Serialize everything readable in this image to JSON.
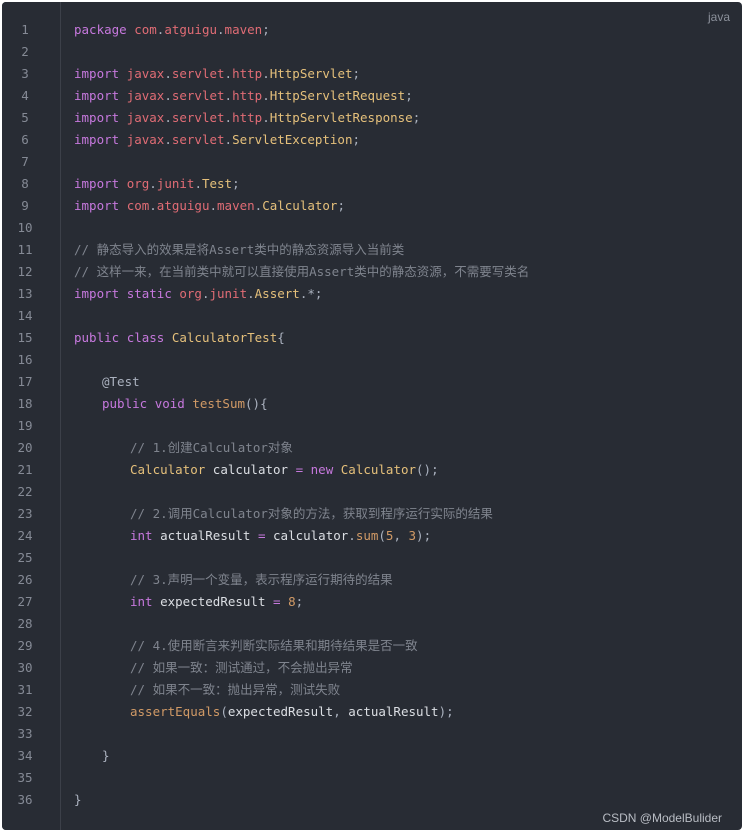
{
  "code_block": {
    "language_label": "java",
    "watermark": "CSDN @ModelBulider",
    "colors": {
      "background": "#282c34",
      "keyword": "#c678dd",
      "package": "#e06c75",
      "class": "#e5c07b",
      "comment": "#7f848e",
      "function_and_number": "#d19a66",
      "plain": "#abb2bf"
    },
    "lines": [
      {
        "n": "1",
        "indent": 0,
        "tokens": [
          [
            "kw",
            "package"
          ],
          [
            "pl",
            " "
          ],
          [
            "pkg",
            "com"
          ],
          [
            "pl",
            "."
          ],
          [
            "pkg",
            "atguigu"
          ],
          [
            "pl",
            "."
          ],
          [
            "pkg",
            "maven"
          ],
          [
            "pl",
            ";"
          ]
        ]
      },
      {
        "n": "2",
        "indent": 0,
        "tokens": []
      },
      {
        "n": "3",
        "indent": 0,
        "tokens": [
          [
            "kw",
            "import"
          ],
          [
            "pl",
            " "
          ],
          [
            "pkg",
            "javax"
          ],
          [
            "pl",
            "."
          ],
          [
            "pkg",
            "servlet"
          ],
          [
            "pl",
            "."
          ],
          [
            "pkg",
            "http"
          ],
          [
            "pl",
            "."
          ],
          [
            "cls",
            "HttpServlet"
          ],
          [
            "pl",
            ";"
          ]
        ]
      },
      {
        "n": "4",
        "indent": 0,
        "tokens": [
          [
            "kw",
            "import"
          ],
          [
            "pl",
            " "
          ],
          [
            "pkg",
            "javax"
          ],
          [
            "pl",
            "."
          ],
          [
            "pkg",
            "servlet"
          ],
          [
            "pl",
            "."
          ],
          [
            "pkg",
            "http"
          ],
          [
            "pl",
            "."
          ],
          [
            "cls",
            "HttpServletRequest"
          ],
          [
            "pl",
            ";"
          ]
        ]
      },
      {
        "n": "5",
        "indent": 0,
        "tokens": [
          [
            "kw",
            "import"
          ],
          [
            "pl",
            " "
          ],
          [
            "pkg",
            "javax"
          ],
          [
            "pl",
            "."
          ],
          [
            "pkg",
            "servlet"
          ],
          [
            "pl",
            "."
          ],
          [
            "pkg",
            "http"
          ],
          [
            "pl",
            "."
          ],
          [
            "cls",
            "HttpServletResponse"
          ],
          [
            "pl",
            ";"
          ]
        ]
      },
      {
        "n": "6",
        "indent": 0,
        "tokens": [
          [
            "kw",
            "import"
          ],
          [
            "pl",
            " "
          ],
          [
            "pkg",
            "javax"
          ],
          [
            "pl",
            "."
          ],
          [
            "pkg",
            "servlet"
          ],
          [
            "pl",
            "."
          ],
          [
            "cls",
            "ServletException"
          ],
          [
            "pl",
            ";"
          ]
        ]
      },
      {
        "n": "7",
        "indent": 0,
        "tokens": []
      },
      {
        "n": "8",
        "indent": 0,
        "tokens": [
          [
            "kw",
            "import"
          ],
          [
            "pl",
            " "
          ],
          [
            "pkg",
            "org"
          ],
          [
            "pl",
            "."
          ],
          [
            "pkg",
            "junit"
          ],
          [
            "pl",
            "."
          ],
          [
            "cls",
            "Test"
          ],
          [
            "pl",
            ";"
          ]
        ]
      },
      {
        "n": "9",
        "indent": 0,
        "tokens": [
          [
            "kw",
            "import"
          ],
          [
            "pl",
            " "
          ],
          [
            "pkg",
            "com"
          ],
          [
            "pl",
            "."
          ],
          [
            "pkg",
            "atguigu"
          ],
          [
            "pl",
            "."
          ],
          [
            "pkg",
            "maven"
          ],
          [
            "pl",
            "."
          ],
          [
            "cls",
            "Calculator"
          ],
          [
            "pl",
            ";"
          ]
        ]
      },
      {
        "n": "10",
        "indent": 0,
        "tokens": []
      },
      {
        "n": "11",
        "indent": 0,
        "tokens": [
          [
            "cm",
            "// 静态导入的效果是将Assert类中的静态资源导入当前类"
          ]
        ]
      },
      {
        "n": "12",
        "indent": 0,
        "tokens": [
          [
            "cm",
            "// 这样一来，在当前类中就可以直接使用Assert类中的静态资源，不需要写类名"
          ]
        ]
      },
      {
        "n": "13",
        "indent": 0,
        "tokens": [
          [
            "kw",
            "import"
          ],
          [
            "pl",
            " "
          ],
          [
            "kw",
            "static"
          ],
          [
            "pl",
            " "
          ],
          [
            "pkg",
            "org"
          ],
          [
            "pl",
            "."
          ],
          [
            "pkg",
            "junit"
          ],
          [
            "pl",
            "."
          ],
          [
            "cls",
            "Assert"
          ],
          [
            "pl",
            ".*;"
          ]
        ]
      },
      {
        "n": "14",
        "indent": 0,
        "tokens": []
      },
      {
        "n": "15",
        "indent": 0,
        "tokens": [
          [
            "kw",
            "public"
          ],
          [
            "pl",
            " "
          ],
          [
            "kw",
            "class"
          ],
          [
            "pl",
            " "
          ],
          [
            "cls",
            "CalculatorTest"
          ],
          [
            "pl",
            "{"
          ]
        ]
      },
      {
        "n": "16",
        "indent": 0,
        "tokens": []
      },
      {
        "n": "17",
        "indent": 1,
        "tokens": [
          [
            "an",
            "@Test"
          ]
        ]
      },
      {
        "n": "18",
        "indent": 1,
        "tokens": [
          [
            "kw",
            "public"
          ],
          [
            "pl",
            " "
          ],
          [
            "kw",
            "void"
          ],
          [
            "pl",
            " "
          ],
          [
            "fn",
            "testSum"
          ],
          [
            "pl",
            "(){"
          ]
        ]
      },
      {
        "n": "19",
        "indent": 0,
        "tokens": []
      },
      {
        "n": "20",
        "indent": 2,
        "tokens": [
          [
            "cm",
            "// 1.创建Calculator对象"
          ]
        ]
      },
      {
        "n": "21",
        "indent": 2,
        "tokens": [
          [
            "cls",
            "Calculator"
          ],
          [
            "pl",
            " "
          ],
          [
            "var",
            "calculator"
          ],
          [
            "pl",
            " "
          ],
          [
            "kw",
            "="
          ],
          [
            "pl",
            " "
          ],
          [
            "kw",
            "new"
          ],
          [
            "pl",
            " "
          ],
          [
            "cls",
            "Calculator"
          ],
          [
            "pl",
            "();"
          ]
        ]
      },
      {
        "n": "22",
        "indent": 0,
        "tokens": []
      },
      {
        "n": "23",
        "indent": 2,
        "tokens": [
          [
            "cm",
            "// 2.调用Calculator对象的方法，获取到程序运行实际的结果"
          ]
        ]
      },
      {
        "n": "24",
        "indent": 2,
        "tokens": [
          [
            "kw",
            "int"
          ],
          [
            "pl",
            " "
          ],
          [
            "var",
            "actualResult"
          ],
          [
            "pl",
            " "
          ],
          [
            "kw",
            "="
          ],
          [
            "pl",
            " "
          ],
          [
            "var",
            "calculator"
          ],
          [
            "pl",
            "."
          ],
          [
            "fn",
            "sum"
          ],
          [
            "pl",
            "("
          ],
          [
            "num",
            "5"
          ],
          [
            "pl",
            ", "
          ],
          [
            "num",
            "3"
          ],
          [
            "pl",
            ");"
          ]
        ]
      },
      {
        "n": "25",
        "indent": 0,
        "tokens": []
      },
      {
        "n": "26",
        "indent": 2,
        "tokens": [
          [
            "cm",
            "// 3.声明一个变量，表示程序运行期待的结果"
          ]
        ]
      },
      {
        "n": "27",
        "indent": 2,
        "tokens": [
          [
            "kw",
            "int"
          ],
          [
            "pl",
            " "
          ],
          [
            "var",
            "expectedResult"
          ],
          [
            "pl",
            " "
          ],
          [
            "kw",
            "="
          ],
          [
            "pl",
            " "
          ],
          [
            "num",
            "8"
          ],
          [
            "pl",
            ";"
          ]
        ]
      },
      {
        "n": "28",
        "indent": 0,
        "tokens": []
      },
      {
        "n": "29",
        "indent": 2,
        "tokens": [
          [
            "cm",
            "// 4.使用断言来判断实际结果和期待结果是否一致"
          ]
        ]
      },
      {
        "n": "30",
        "indent": 2,
        "tokens": [
          [
            "cm",
            "// 如果一致：测试通过，不会抛出异常"
          ]
        ]
      },
      {
        "n": "31",
        "indent": 2,
        "tokens": [
          [
            "cm",
            "// 如果不一致：抛出异常，测试失败"
          ]
        ]
      },
      {
        "n": "32",
        "indent": 2,
        "tokens": [
          [
            "fn",
            "assertEquals"
          ],
          [
            "pl",
            "("
          ],
          [
            "var",
            "expectedResult"
          ],
          [
            "pl",
            ", "
          ],
          [
            "var",
            "actualResult"
          ],
          [
            "pl",
            ");"
          ]
        ]
      },
      {
        "n": "33",
        "indent": 0,
        "tokens": []
      },
      {
        "n": "34",
        "indent": 1,
        "tokens": [
          [
            "pl",
            "}"
          ]
        ]
      },
      {
        "n": "35",
        "indent": 0,
        "tokens": []
      },
      {
        "n": "36",
        "indent": 0,
        "tokens": [
          [
            "pl",
            "}"
          ]
        ]
      }
    ]
  }
}
